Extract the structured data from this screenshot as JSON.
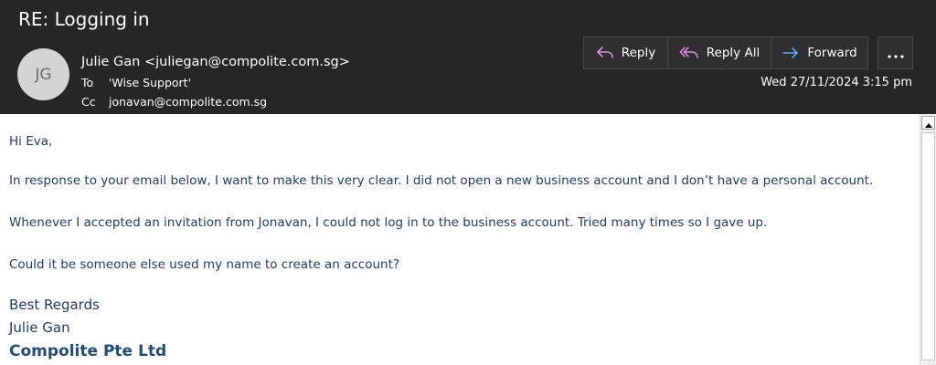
{
  "header": {
    "subject": "RE: Logging in",
    "avatar_initials": "JG",
    "from": "Julie Gan <juliegan@compolite.com.sg>",
    "to_label": "To",
    "to_value": "'Wise Support'",
    "cc_label": "Cc",
    "cc_value": "jonavan@compolite.com.sg",
    "date": "Wed 27/11/2024 3:15 pm"
  },
  "actions": {
    "reply": "Reply",
    "reply_all": "Reply All",
    "forward": "Forward",
    "more_icon": "ellipsis-icon"
  },
  "body": {
    "greeting": "Hi Eva,",
    "paragraphs": [
      "In response to your email below, I want to make this very clear. I did not open a new business account and I don’t have a personal account.",
      "Whenever I accepted an invitation from Jonavan, I could not log in to the business account. Tried many times so I gave up.",
      "Could it be someone else used my name to create an account?"
    ],
    "signature": {
      "closing": "Best Regards",
      "name": "Julie Gan",
      "company": "Compolite Pte Ltd"
    }
  },
  "colors": {
    "header_bg": "#262626",
    "body_text": "#1f3f66",
    "reply_icon": "#d98fe0",
    "forward_icon": "#5aa7f0"
  }
}
